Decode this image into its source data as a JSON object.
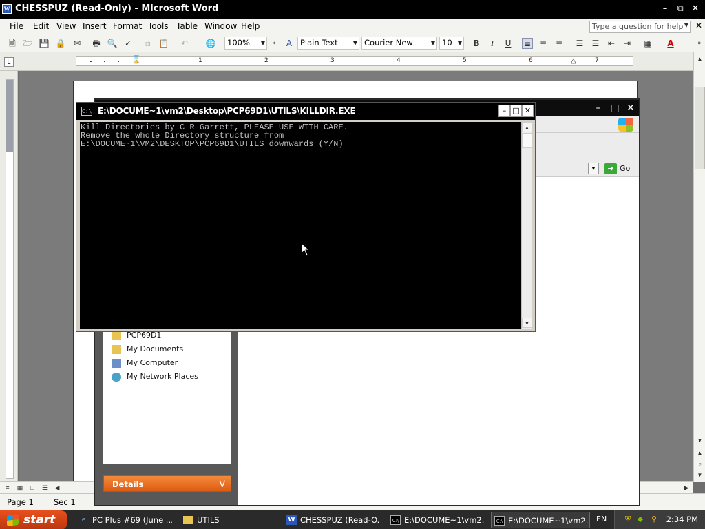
{
  "word": {
    "title": "CHESSPUZ (Read-Only) - Microsoft Word",
    "menu": [
      "File",
      "Edit",
      "View",
      "Insert",
      "Format",
      "Tools",
      "Table",
      "Window",
      "Help"
    ],
    "help_placeholder": "Type a question for help",
    "zoom": "100%",
    "style": "Plain Text",
    "font": "Courier New",
    "font_size": "10",
    "ruler_numbers": [
      "1",
      "2",
      "3",
      "4",
      "5",
      "6",
      "7"
    ],
    "status": {
      "page": "Page 1",
      "section": "Sec 1"
    }
  },
  "explorer": {
    "go_label": "Go",
    "places": [
      "PCP69D1",
      "My Documents",
      "My Computer",
      "My Network Places"
    ],
    "details_label": "Details"
  },
  "console": {
    "title": "E:\\DOCUME~1\\vm2\\Desktop\\PCP69D1\\UTILS\\KILLDIR.EXE",
    "lines": [
      "Kill Directories by C R Garrett, PLEASE USE WITH CARE.",
      "Remove the whole Directory structure from",
      "E:\\DOCUME~1\\VM2\\DESKTOP\\PCP69D1\\UTILS downwards (Y/N)"
    ]
  },
  "taskbar": {
    "start_label": "start",
    "tasks": [
      {
        "label": "PC Plus #69 (June ...",
        "icon": "ie-icon"
      },
      {
        "label": "UTILS",
        "icon": "folder-icon"
      },
      {
        "label": "CHESSPUZ (Read-O...",
        "icon": "word-icon"
      },
      {
        "label": "E:\\DOCUME~1\\vm2...",
        "icon": "console-icon"
      },
      {
        "label": "E:\\DOCUME~1\\vm2...",
        "icon": "console-icon"
      }
    ],
    "language": "EN",
    "clock": "2:34 PM"
  }
}
